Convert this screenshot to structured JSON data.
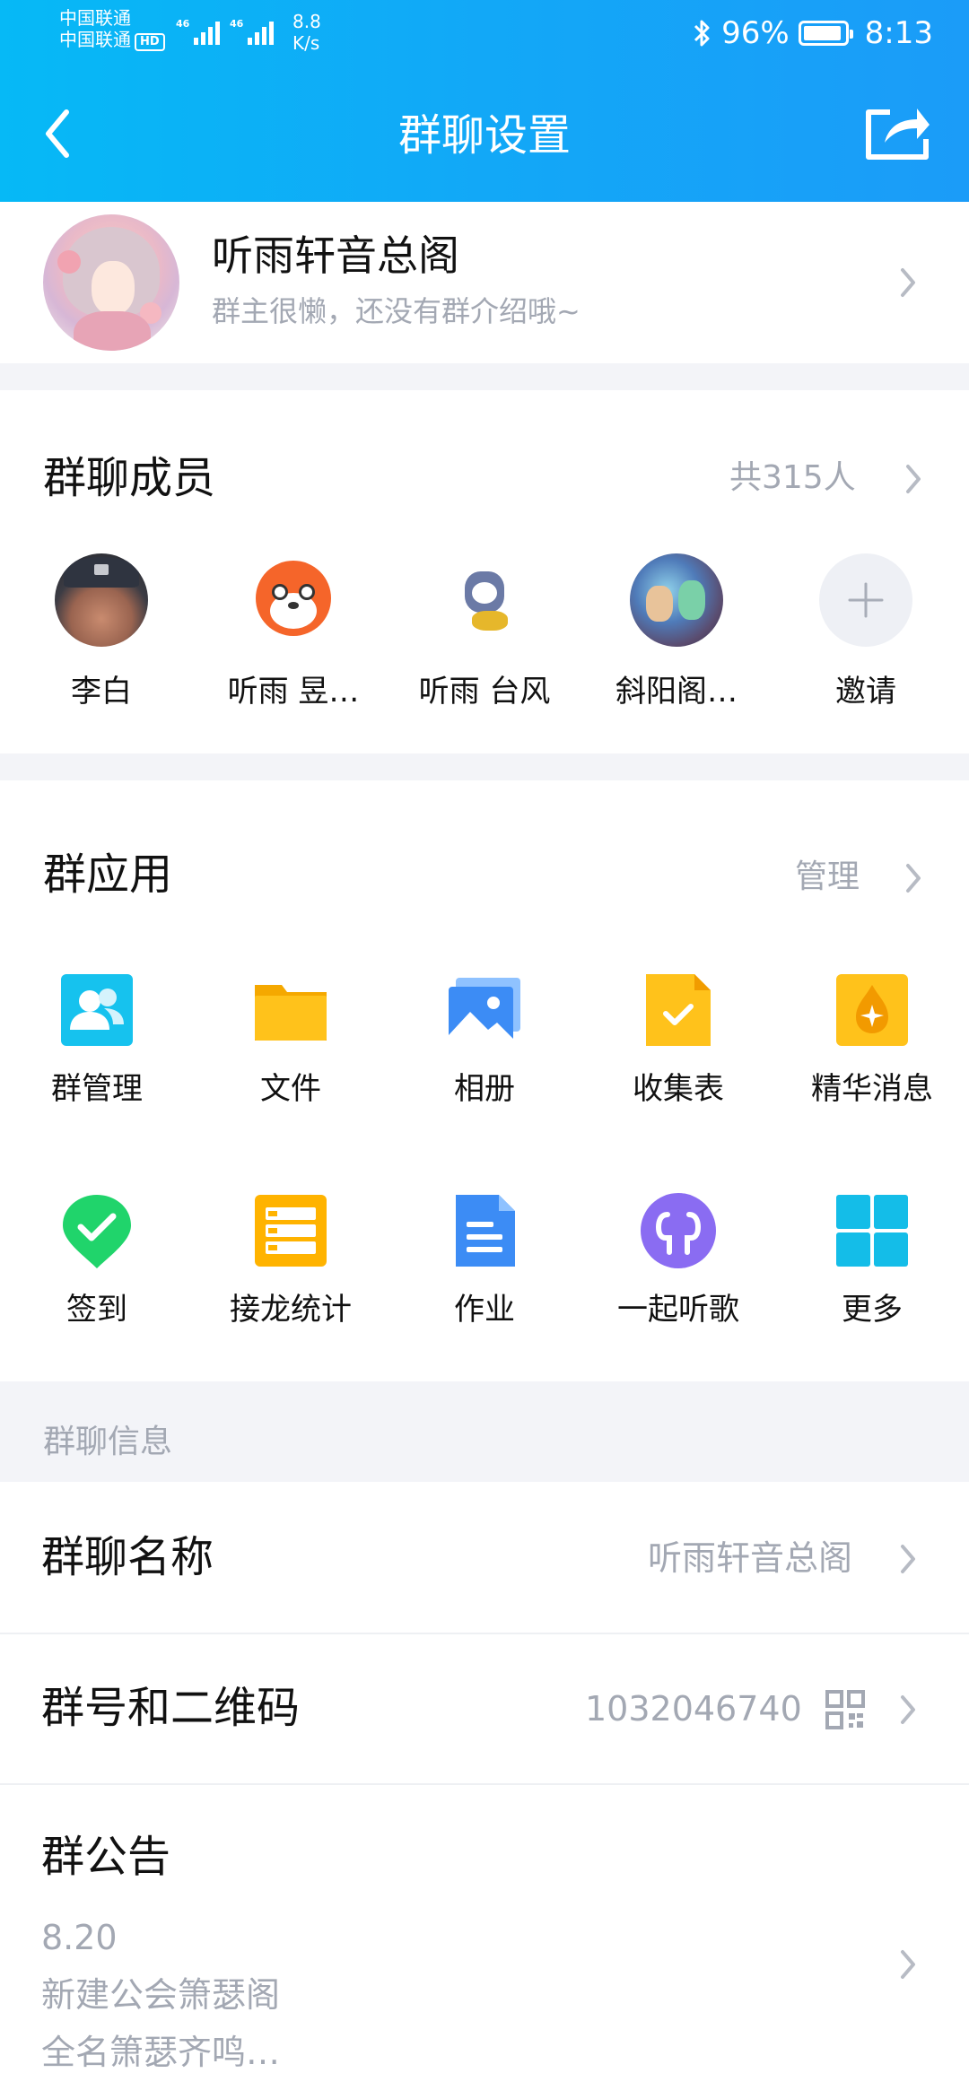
{
  "status_bar": {
    "carrier1": "中国联通",
    "carrier2": "中国联通",
    "hd": "HD",
    "net1": "46",
    "net2": "46",
    "speed_value": "8.8",
    "speed_unit": "K/s",
    "battery": "96%",
    "time": "8:13"
  },
  "titlebar": {
    "title": "群聊设置"
  },
  "group": {
    "name": "听雨轩音总阁",
    "description": "群主很懒，还没有群介绍哦~"
  },
  "members": {
    "title": "群聊成员",
    "count": "共315人",
    "list": [
      {
        "name": "李白"
      },
      {
        "name": "听雨 昱…"
      },
      {
        "name": "听雨 台风"
      },
      {
        "name": "斜阳阁…"
      },
      {
        "name": "邀请"
      }
    ]
  },
  "apps": {
    "title": "群应用",
    "manage": "管理",
    "items": [
      {
        "label": "群管理",
        "icon": "group-manage-icon"
      },
      {
        "label": "文件",
        "icon": "folder-icon"
      },
      {
        "label": "相册",
        "icon": "album-icon"
      },
      {
        "label": "收集表",
        "icon": "collect-form-icon"
      },
      {
        "label": "精华消息",
        "icon": "essence-icon"
      },
      {
        "label": "签到",
        "icon": "checkin-icon"
      },
      {
        "label": "接龙统计",
        "icon": "solitaire-icon"
      },
      {
        "label": "作业",
        "icon": "homework-icon"
      },
      {
        "label": "一起听歌",
        "icon": "headphones-icon"
      },
      {
        "label": "更多",
        "icon": "grid-icon"
      }
    ]
  },
  "info": {
    "header": "群聊信息",
    "name_label": "群聊名称",
    "name_value": "听雨轩音总阁",
    "number_label": "群号和二维码",
    "number_value": "1032046740",
    "notice_label": "群公告",
    "notice_lines": [
      "8.20",
      "新建公会箫瑟阁",
      "全名箫瑟齐鸣…"
    ]
  },
  "colors": {
    "header_gradient_start": "#06b9f6",
    "header_gradient_end": "#1b9cf8",
    "secondary_text": "#a3a8b3",
    "section_bg": "#f3f4f8"
  }
}
